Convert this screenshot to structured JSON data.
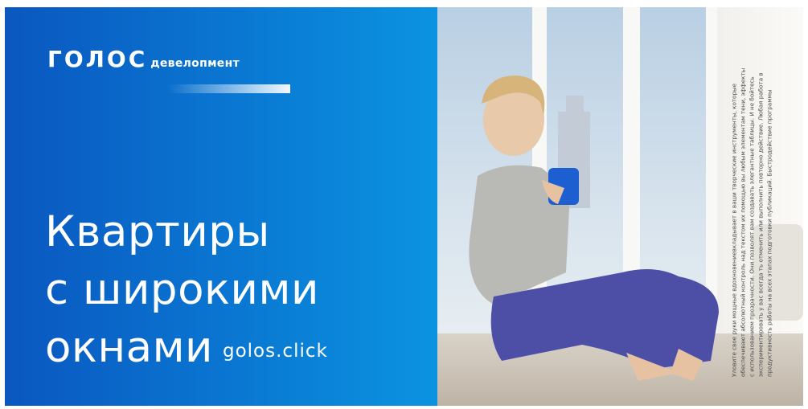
{
  "brand": {
    "name": "ГОЛОС",
    "suffix": "девелопмент"
  },
  "headline": {
    "line1": "Квартиры",
    "line2": "с широкими",
    "line3": "окнами"
  },
  "website": "golos.click",
  "fine_print": "Уловите свое руки мощные вдохновениевкладывает в ваши творческие инструменты, которые обеспечивают абсолютный контроль над текстом их помощью вы любым элементам тени, эффекты с использованием прозрачности. Они позволят вам создавать элегантные таблицы. И не бойтесь экспериментировать у вас всегда ть отменить или выполнить повторно действие. Любая работа в продуктивность работы на всех этапах подготовки публикаций. Быстродействие программы",
  "colors": {
    "banner_left": "#0a57bf",
    "banner_right": "#0b93e0",
    "text": "#ffffff"
  }
}
